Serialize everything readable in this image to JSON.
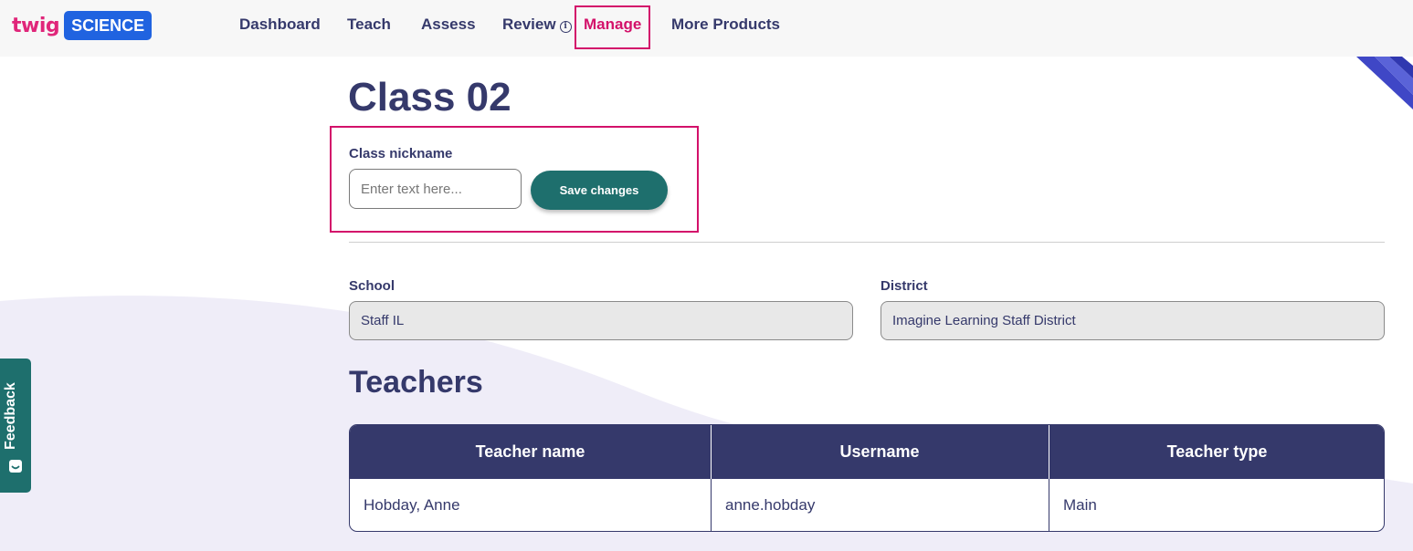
{
  "brand": {
    "logo_text": "twig",
    "logo_badge": "SCIENCE"
  },
  "nav": {
    "dashboard": "Dashboard",
    "teach": "Teach",
    "assess": "Assess",
    "review": "Review",
    "manage": "Manage",
    "more_products": "More Products"
  },
  "page": {
    "title": "Class 02"
  },
  "nickname": {
    "label": "Class nickname",
    "placeholder": "Enter text here...",
    "value": "",
    "save_label": "Save changes"
  },
  "school": {
    "label": "School",
    "value": "Staff IL"
  },
  "district": {
    "label": "District",
    "value": "Imagine Learning Staff District"
  },
  "teachers": {
    "title": "Teachers",
    "columns": [
      "Teacher name",
      "Username",
      "Teacher type"
    ],
    "rows": [
      [
        "Hobday, Anne",
        "anne.hobday",
        "Main"
      ]
    ]
  },
  "feedback": {
    "label": "Feedback"
  },
  "colors": {
    "primary_navy": "#35396b",
    "accent_pink": "#d3116a",
    "teal": "#1e6f6d",
    "brand_blue": "#2063e0"
  },
  "icons": [
    "info-icon",
    "feedback-smile-icon"
  ]
}
